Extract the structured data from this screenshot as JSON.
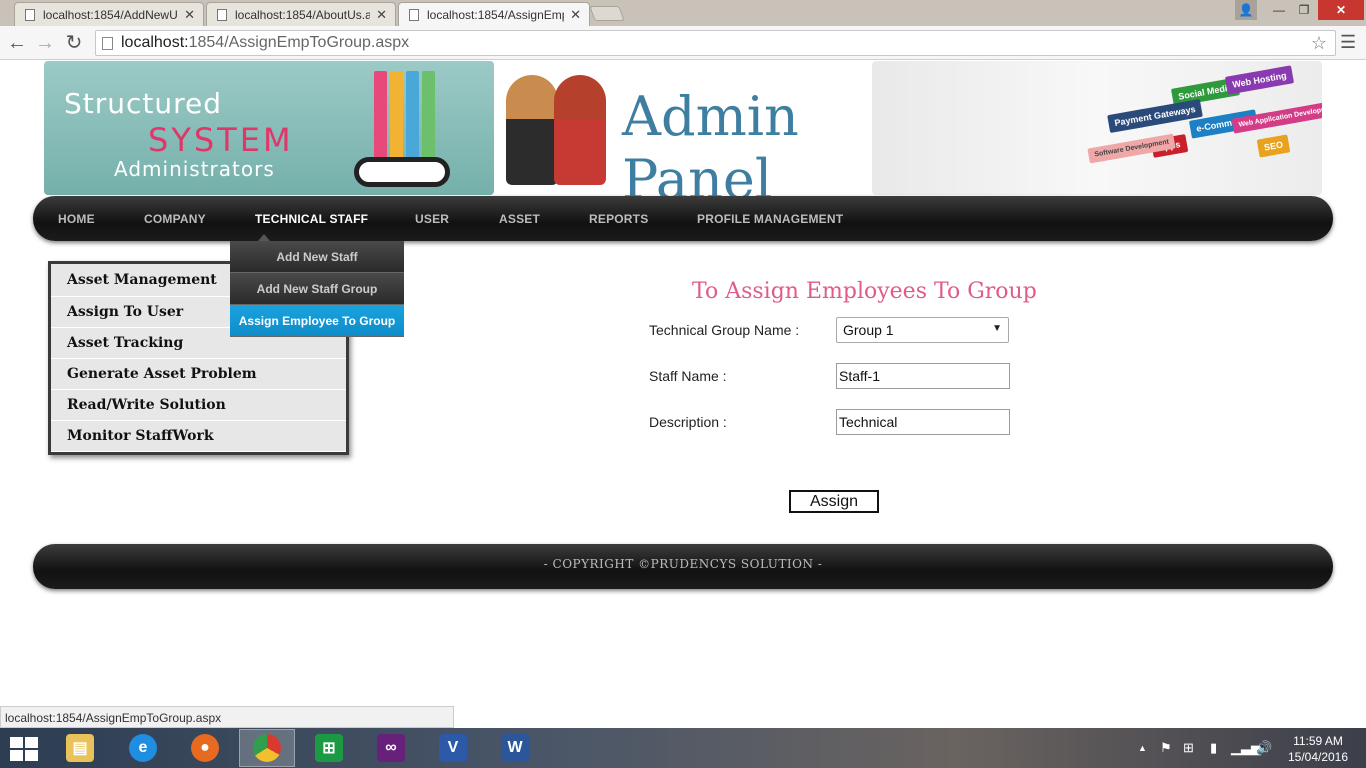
{
  "browser": {
    "tabs": [
      {
        "title": "localhost:1854/AddNewU",
        "active": false
      },
      {
        "title": "localhost:1854/AboutUs.a",
        "active": false
      },
      {
        "title": "localhost:1854/AssignEmp",
        "active": true
      }
    ],
    "url_host": "localhost:",
    "url_path": "1854/AssignEmpToGroup.aspx",
    "status_url": "localhost:1854/AssignEmpToGroup.aspx"
  },
  "banner": {
    "line1": "Structured",
    "line2": "SYSTEM",
    "line3": "Administrators",
    "admin_title": "Admin Panel",
    "signs": [
      "Social Media",
      "Web Hosting",
      "Payment Gateways",
      "e-Commerce",
      "Web Application Development",
      "Apps",
      "SEO",
      "Software Development"
    ]
  },
  "nav": {
    "items": [
      {
        "label": "HOME"
      },
      {
        "label": "COMPANY"
      },
      {
        "label": "TECHNICAL STAFF"
      },
      {
        "label": "USER"
      },
      {
        "label": "ASSET"
      },
      {
        "label": "REPORTS"
      },
      {
        "label": "PROFILE MANAGEMENT"
      }
    ],
    "active_item": "TECHNICAL STAFF",
    "dropdown": [
      {
        "label": "Add New Staff"
      },
      {
        "label": "Add New Staff Group"
      },
      {
        "label": "Assign Employee To Group"
      }
    ],
    "active_dropdown": "Assign Employee To Group"
  },
  "sidemenu": {
    "items": [
      {
        "label": "Asset Management"
      },
      {
        "label": "Assign To User"
      },
      {
        "label": "Asset Tracking"
      },
      {
        "label": "Generate Asset Problem"
      },
      {
        "label": "Read/Write Solution"
      },
      {
        "label": "Monitor StaffWork"
      }
    ]
  },
  "form": {
    "title": "To Assign Employees To Group",
    "group_label": "Technical Group Name :",
    "group_value": "Group 1",
    "staff_label": "Staff Name :",
    "staff_value": "Staff-1",
    "desc_label": "Description :",
    "desc_value": "Technical",
    "submit_label": "Assign"
  },
  "footer": {
    "text": "- COPYRIGHT ©PRUDENCYS SOLUTION -"
  },
  "taskbar": {
    "apps": [
      "file-explorer",
      "internet-explorer",
      "firefox",
      "chrome",
      "store",
      "visual-studio",
      "visio",
      "word"
    ],
    "active_app": "chrome",
    "time": "11:59 AM",
    "date": "15/04/2016"
  },
  "colors": {
    "accent_blue": "#0e8cc8",
    "title_pink": "#e05a8a",
    "nav_dark": "#111111"
  }
}
